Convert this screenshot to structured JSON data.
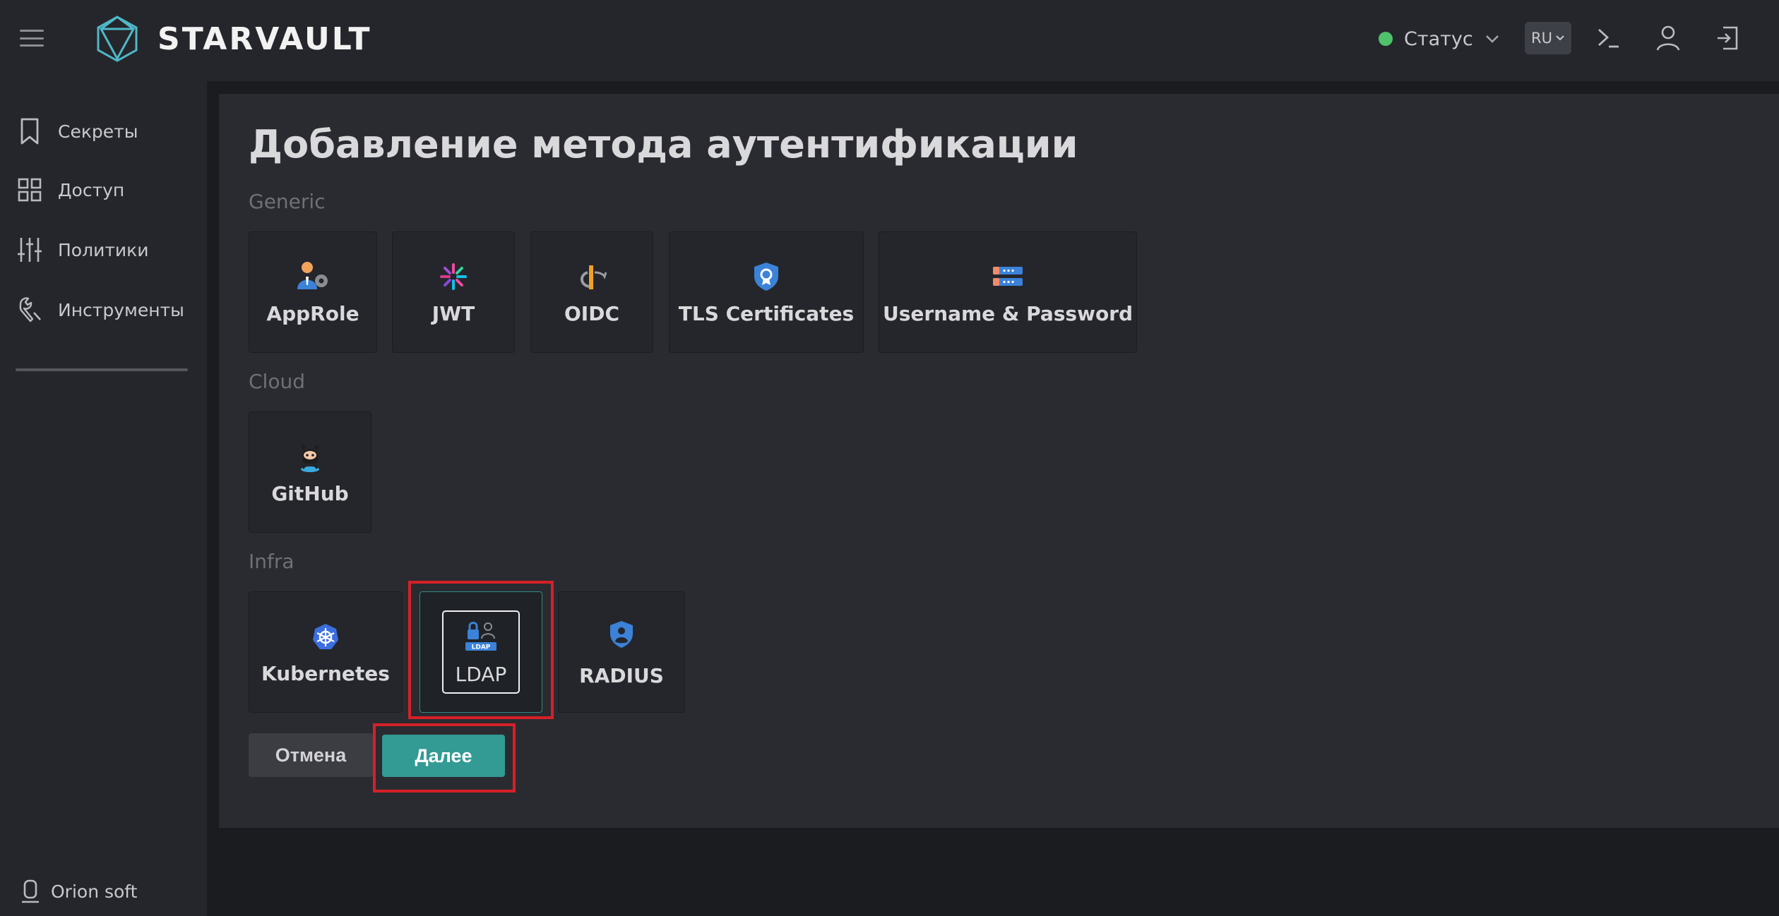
{
  "header": {
    "brand": "STARVAULT",
    "status_label": "Статус",
    "language": "RU",
    "colors": {
      "status_ok": "#4fc26b",
      "accent": "#339a94"
    }
  },
  "sidebar": {
    "items": [
      {
        "label": "Секреты",
        "icon": "bookmark-icon"
      },
      {
        "label": "Доступ",
        "icon": "grid-icon"
      },
      {
        "label": "Политики",
        "icon": "sliders-icon"
      },
      {
        "label": "Инструменты",
        "icon": "tools-icon"
      }
    ],
    "footer": "Orion soft"
  },
  "main": {
    "title": "Добавление метода аутентификации",
    "sections": [
      {
        "label": "Generic",
        "methods": [
          {
            "name": "AppRole",
            "icon": "approle-icon"
          },
          {
            "name": "JWT",
            "icon": "jwt-icon"
          },
          {
            "name": "OIDC",
            "icon": "oidc-icon"
          },
          {
            "name": "TLS Certificates",
            "icon": "certificate-icon"
          },
          {
            "name": "Username & Password",
            "icon": "userpass-icon"
          }
        ]
      },
      {
        "label": "Cloud",
        "methods": [
          {
            "name": "GitHub",
            "icon": "github-icon"
          }
        ]
      },
      {
        "label": "Infra",
        "methods": [
          {
            "name": "Kubernetes",
            "icon": "kubernetes-icon"
          },
          {
            "name": "LDAP",
            "icon": "ldap-icon",
            "selected": true,
            "icon_text": "LDAP"
          },
          {
            "name": "RADIUS",
            "icon": "radius-icon"
          }
        ]
      }
    ],
    "actions": {
      "cancel": "Отмена",
      "next": "Далее"
    }
  }
}
